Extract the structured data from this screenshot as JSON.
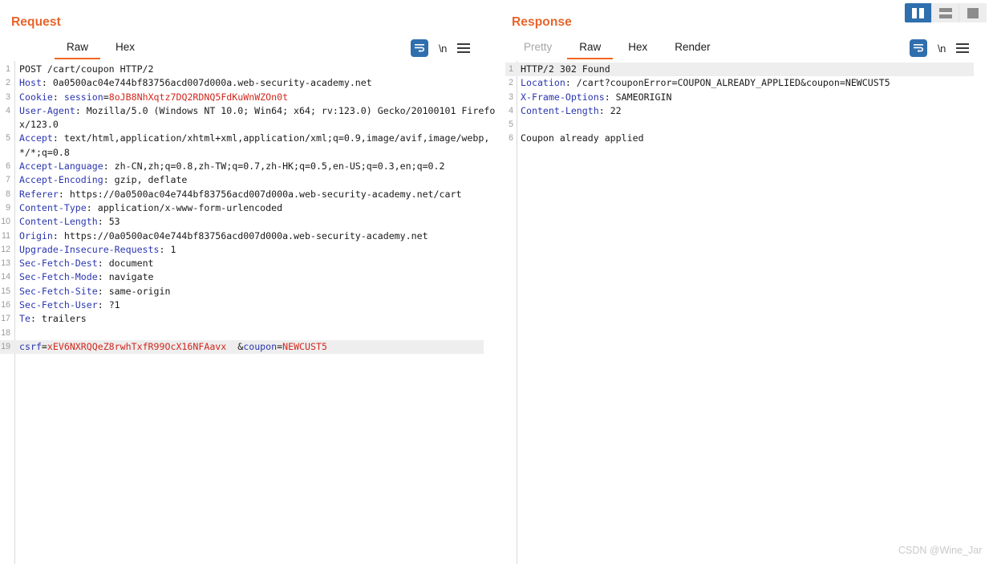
{
  "layout_switcher": {
    "buttons": [
      {
        "name": "side-by-side-layout",
        "icon": "split-view-icon",
        "selected": true
      },
      {
        "name": "stacked-layout",
        "icon": "stacked-view-icon",
        "selected": false
      },
      {
        "name": "single-pane-layout",
        "icon": "single-view-icon",
        "selected": false
      }
    ]
  },
  "request": {
    "title": "Request",
    "tabs": [
      {
        "label": "Raw",
        "active": true,
        "dim": false
      },
      {
        "label": "Hex",
        "active": false,
        "dim": false
      }
    ],
    "tools": {
      "wrap_icon": "word-wrap-icon",
      "newline_label": "\\n",
      "menu_icon": "hamburger-menu-icon"
    },
    "lines": [
      {
        "n": "1",
        "highlight": false,
        "parts": [
          {
            "t": "POST /cart/coupon HTTP/2",
            "c": "v"
          }
        ]
      },
      {
        "n": "2",
        "highlight": false,
        "parts": [
          {
            "t": "Host",
            "c": "k"
          },
          {
            "t": ": 0a0500ac04e744bf83756acd007d000a.web-security-academy.net",
            "c": "v"
          }
        ]
      },
      {
        "n": "3",
        "highlight": false,
        "parts": [
          {
            "t": "Cookie",
            "c": "k"
          },
          {
            "t": ": ",
            "c": "v"
          },
          {
            "t": "session",
            "c": "bl"
          },
          {
            "t": "=",
            "c": "v"
          },
          {
            "t": "8oJB8NhXqtz7DQ2RDNQ5FdKuWnWZOn0t",
            "c": "rd"
          }
        ]
      },
      {
        "n": "4",
        "highlight": false,
        "parts": [
          {
            "t": "User-Agent",
            "c": "k"
          },
          {
            "t": ": Mozilla/5.0 (Windows NT 10.0; Win64; x64; rv:123.0) Gecko/20100101 Firefox/123.0",
            "c": "v"
          }
        ]
      },
      {
        "n": "5",
        "highlight": false,
        "parts": [
          {
            "t": "Accept",
            "c": "k"
          },
          {
            "t": ": text/html,application/xhtml+xml,application/xml;q=0.9,image/avif,image/webp,*/*;q=0.8",
            "c": "v"
          }
        ]
      },
      {
        "n": "6",
        "highlight": false,
        "parts": [
          {
            "t": "Accept-Language",
            "c": "k"
          },
          {
            "t": ": zh-CN,zh;q=0.8,zh-TW;q=0.7,zh-HK;q=0.5,en-US;q=0.3,en;q=0.2",
            "c": "v"
          }
        ]
      },
      {
        "n": "7",
        "highlight": false,
        "parts": [
          {
            "t": "Accept-Encoding",
            "c": "k"
          },
          {
            "t": ": gzip, deflate",
            "c": "v"
          }
        ]
      },
      {
        "n": "8",
        "highlight": false,
        "parts": [
          {
            "t": "Referer",
            "c": "k"
          },
          {
            "t": ": https://0a0500ac04e744bf83756acd007d000a.web-security-academy.net/cart",
            "c": "v"
          }
        ]
      },
      {
        "n": "9",
        "highlight": false,
        "parts": [
          {
            "t": "Content-Type",
            "c": "k"
          },
          {
            "t": ": application/x-www-form-urlencoded",
            "c": "v"
          }
        ]
      },
      {
        "n": "10",
        "highlight": false,
        "parts": [
          {
            "t": "Content-Length",
            "c": "k"
          },
          {
            "t": ": 53",
            "c": "v"
          }
        ]
      },
      {
        "n": "11",
        "highlight": false,
        "parts": [
          {
            "t": "Origin",
            "c": "k"
          },
          {
            "t": ": https://0a0500ac04e744bf83756acd007d000a.web-security-academy.net",
            "c": "v"
          }
        ]
      },
      {
        "n": "12",
        "highlight": false,
        "parts": [
          {
            "t": "Upgrade-Insecure-Requests",
            "c": "k"
          },
          {
            "t": ": 1",
            "c": "v"
          }
        ]
      },
      {
        "n": "13",
        "highlight": false,
        "parts": [
          {
            "t": "Sec-Fetch-Dest",
            "c": "k"
          },
          {
            "t": ": document",
            "c": "v"
          }
        ]
      },
      {
        "n": "14",
        "highlight": false,
        "parts": [
          {
            "t": "Sec-Fetch-Mode",
            "c": "k"
          },
          {
            "t": ": navigate",
            "c": "v"
          }
        ]
      },
      {
        "n": "15",
        "highlight": false,
        "parts": [
          {
            "t": "Sec-Fetch-Site",
            "c": "k"
          },
          {
            "t": ": same-origin",
            "c": "v"
          }
        ]
      },
      {
        "n": "16",
        "highlight": false,
        "parts": [
          {
            "t": "Sec-Fetch-User",
            "c": "k"
          },
          {
            "t": ": ?1",
            "c": "v"
          }
        ]
      },
      {
        "n": "17",
        "highlight": false,
        "parts": [
          {
            "t": "Te",
            "c": "k"
          },
          {
            "t": ": trailers",
            "c": "v"
          }
        ]
      },
      {
        "n": "18",
        "highlight": false,
        "parts": [
          {
            "t": "",
            "c": "v"
          }
        ]
      },
      {
        "n": "19",
        "highlight": true,
        "parts": [
          {
            "t": "csrf",
            "c": "bl"
          },
          {
            "t": "=",
            "c": "v"
          },
          {
            "t": "xEV6NXRQQeZ8rwhTxfR99OcX16NFAavx",
            "c": "rd"
          },
          {
            "t": "  &",
            "c": "v"
          },
          {
            "t": "coupon",
            "c": "bl"
          },
          {
            "t": "=",
            "c": "v"
          },
          {
            "t": "NEWCUST5",
            "c": "rd"
          }
        ]
      }
    ]
  },
  "response": {
    "title": "Response",
    "tabs": [
      {
        "label": "Pretty",
        "active": false,
        "dim": true
      },
      {
        "label": "Raw",
        "active": true,
        "dim": false
      },
      {
        "label": "Hex",
        "active": false,
        "dim": false
      },
      {
        "label": "Render",
        "active": false,
        "dim": false
      }
    ],
    "tools": {
      "wrap_icon": "word-wrap-icon",
      "newline_label": "\\n",
      "menu_icon": "hamburger-menu-icon"
    },
    "lines": [
      {
        "n": "1",
        "highlight": true,
        "parts": [
          {
            "t": "HTTP/2 302 Found",
            "c": "v"
          }
        ]
      },
      {
        "n": "2",
        "highlight": false,
        "parts": [
          {
            "t": "Location",
            "c": "k"
          },
          {
            "t": ": /cart?couponError=COUPON_ALREADY_APPLIED&coupon=NEWCUST5",
            "c": "v"
          }
        ]
      },
      {
        "n": "3",
        "highlight": false,
        "parts": [
          {
            "t": "X-Frame-Options",
            "c": "k"
          },
          {
            "t": ": SAMEORIGIN",
            "c": "v"
          }
        ]
      },
      {
        "n": "4",
        "highlight": false,
        "parts": [
          {
            "t": "Content-Length",
            "c": "k"
          },
          {
            "t": ": 22",
            "c": "v"
          }
        ]
      },
      {
        "n": "5",
        "highlight": false,
        "parts": [
          {
            "t": "",
            "c": "v"
          }
        ]
      },
      {
        "n": "6",
        "highlight": false,
        "parts": [
          {
            "t": "Coupon already applied",
            "c": "v"
          }
        ]
      }
    ]
  },
  "watermark": {
    "text": "CSDN @Wine_Jar"
  },
  "colors": {
    "accent_orange": "#f26522",
    "title_orange": "#e8642a",
    "header_blue": "#2b36b0",
    "value_red": "#d1281e",
    "selected_blue": "#2f6fad",
    "highlight_gray": "#eeeeee"
  }
}
